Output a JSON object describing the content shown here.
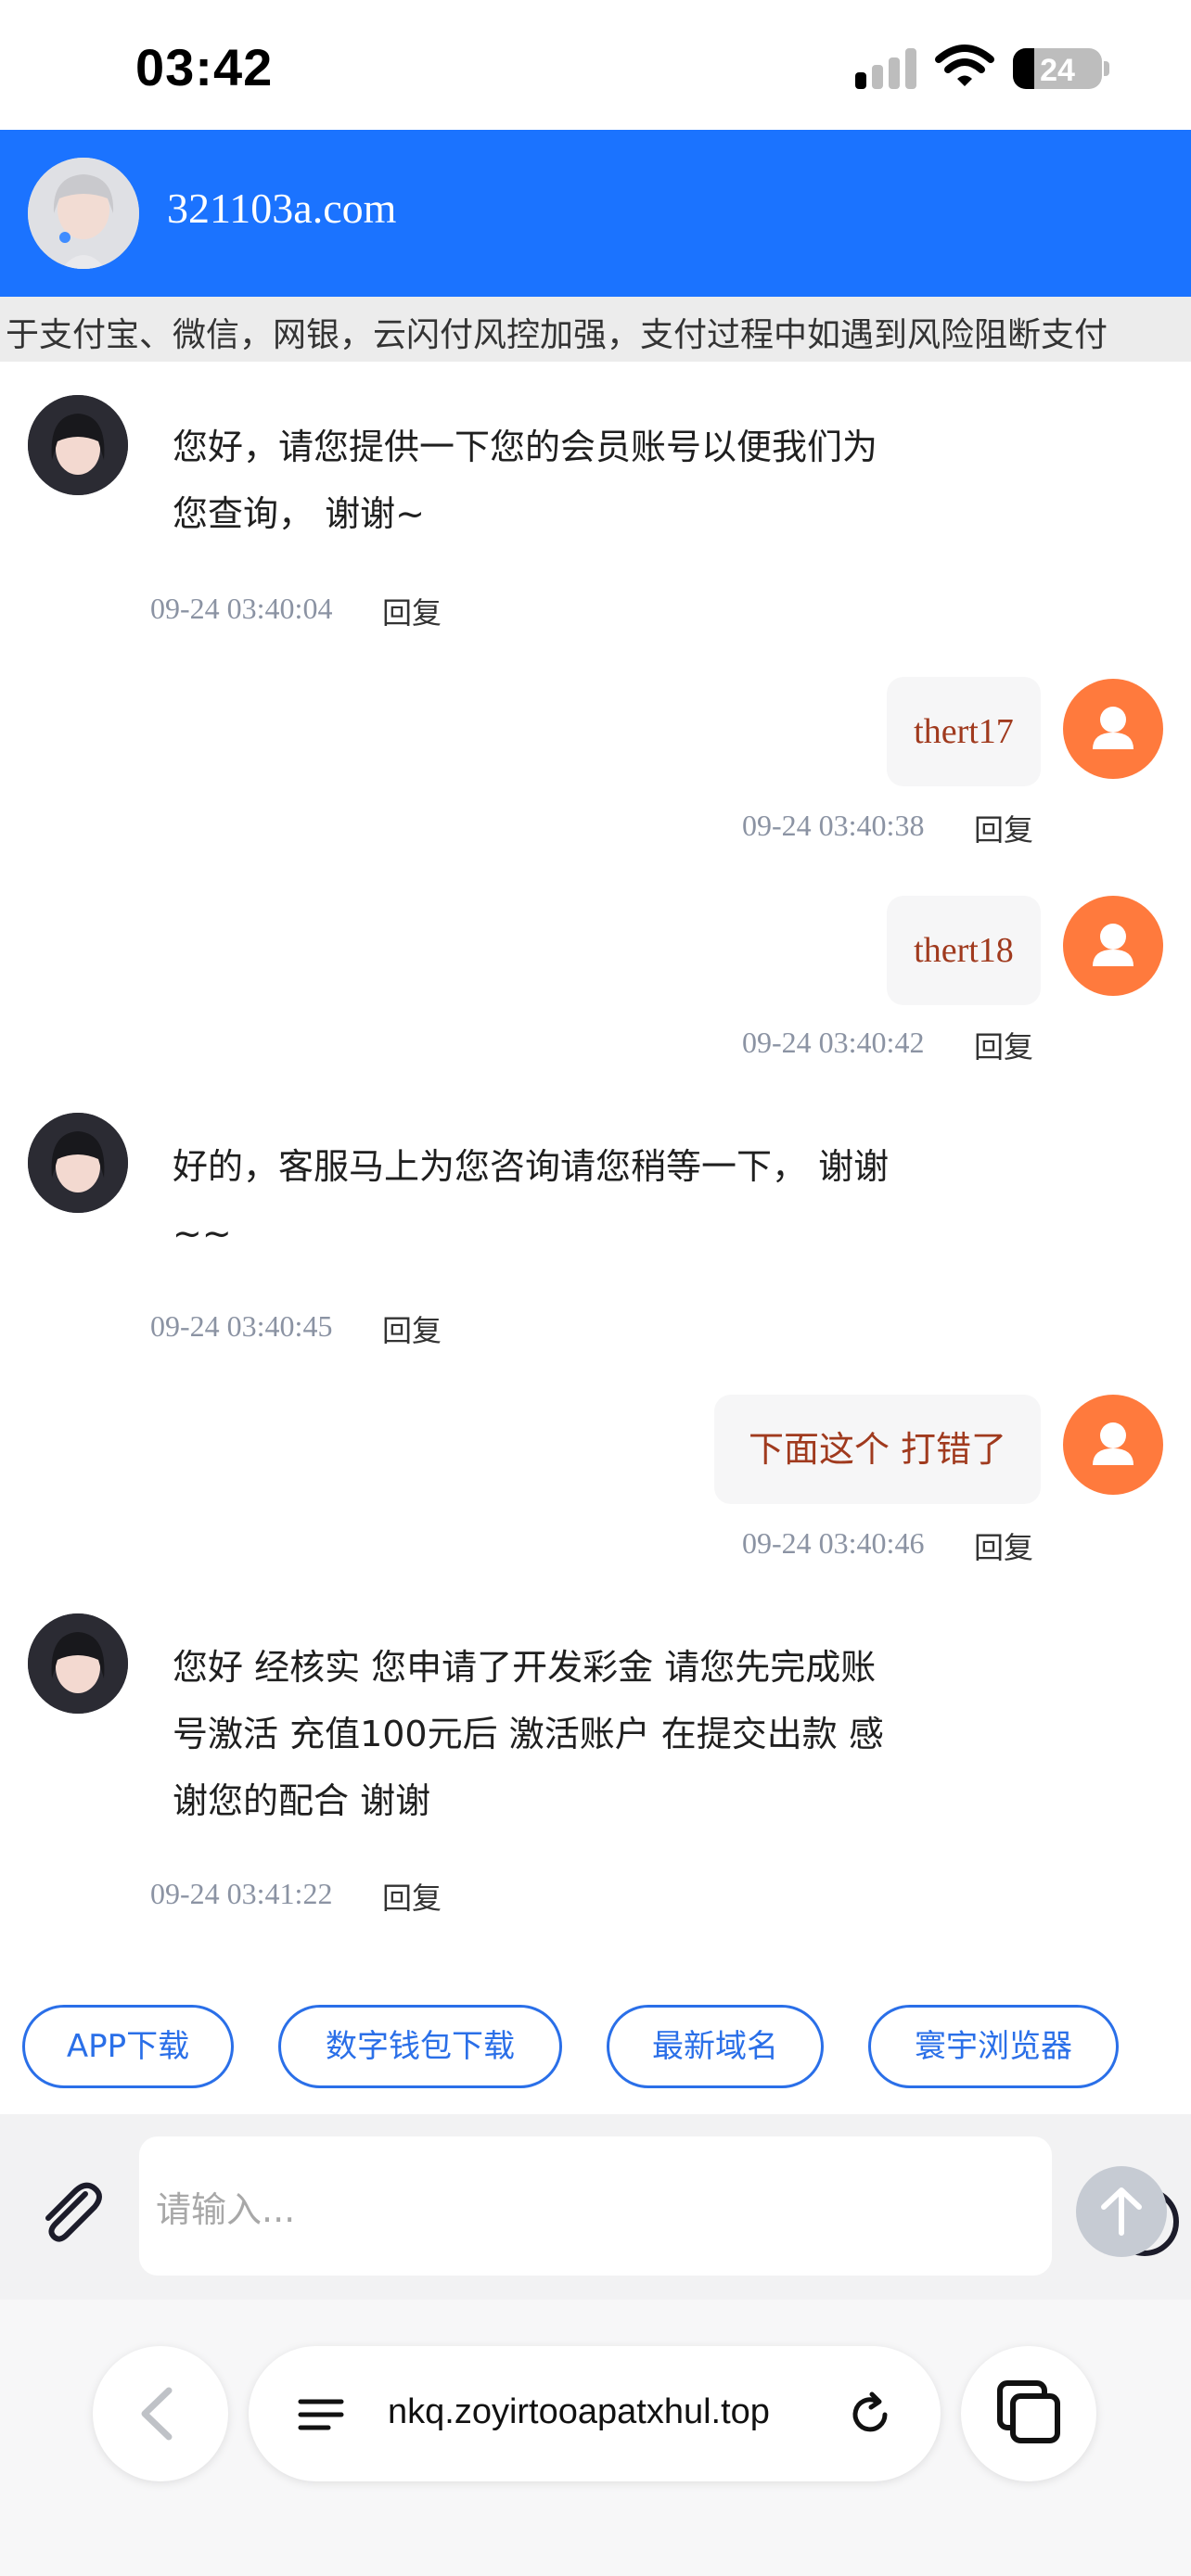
{
  "status_bar": {
    "time": "03:42",
    "battery": "24",
    "battery_level": 0.24
  },
  "header": {
    "title": "321103a.com",
    "avatar_icon": "agent-avatar-photo"
  },
  "notice": {
    "text": "于支付宝、微信，网银，云闪付风控加强，支付过程中如遇到风险阻断支付"
  },
  "messages": [
    {
      "from": "agent",
      "text_lines": [
        "您好，请您提供一下您的会员账号以便我们为",
        "您查询， 谢谢~"
      ],
      "time": "09-24 03:40:04",
      "reply": "回复"
    },
    {
      "from": "user",
      "text": "thert17",
      "time": "09-24 03:40:38",
      "reply": "回复"
    },
    {
      "from": "user",
      "text": "thert18",
      "time": "09-24 03:40:42",
      "reply": "回复"
    },
    {
      "from": "agent",
      "text_lines": [
        "好的，客服马上为您咨询请您稍等一下， 谢谢",
        "~~"
      ],
      "time": "09-24 03:40:45",
      "reply": "回复"
    },
    {
      "from": "user",
      "text": "下面这个 打错了",
      "time": "09-24 03:40:46",
      "reply": "回复"
    },
    {
      "from": "agent",
      "text_lines": [
        "您好   经核实 您申请了开发彩金 请您先完成账",
        "号激活 充值100元后  激活账户  在提交出款   感",
        "谢您的配合   谢谢"
      ],
      "time": "09-24 03:41:22",
      "reply": "回复"
    }
  ],
  "quick_links": [
    "APP下载",
    "数字钱包下载",
    "最新域名",
    "寰宇浏览器"
  ],
  "input": {
    "placeholder": "请输入..."
  },
  "browser": {
    "url": "nkq.zoyirtooapatxhul.top"
  },
  "colors": {
    "header": "#1b73ff",
    "user_avatar": "#ff7a3d",
    "link": "#2a6fe8",
    "user_text": "#a03a1e"
  }
}
